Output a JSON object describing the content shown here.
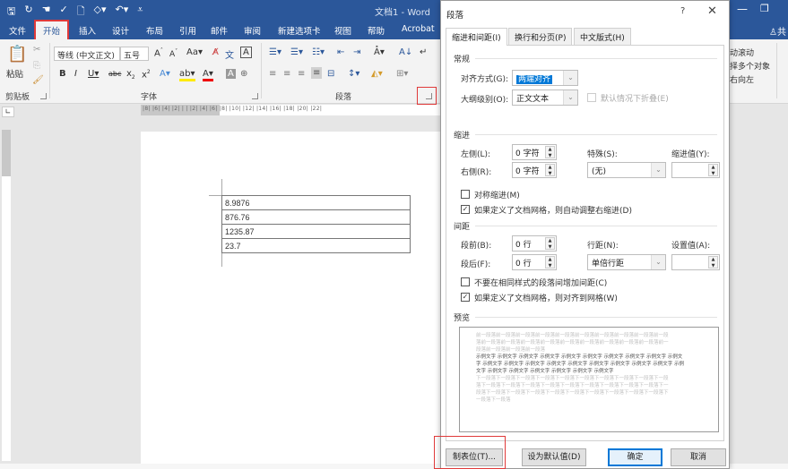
{
  "window": {
    "title": "文档1  -  Word",
    "minimize_icon": "minimize-icon",
    "restore_icon": "restore-icon"
  },
  "qat": {
    "icons": [
      "save-icon",
      "autosave-icon",
      "touch-mode-icon",
      "format-painter-icon",
      "print-preview-icon",
      "shapes-icon",
      "undo-icon",
      "customize-icon"
    ]
  },
  "ribbon_tabs": [
    "文件",
    "开始",
    "插入",
    "设计",
    "布局",
    "引用",
    "邮件",
    "审阅",
    "新建选项卡",
    "视图",
    "帮助",
    "Acrobat"
  ],
  "active_tab": "开始",
  "share_label": "共",
  "ribbon": {
    "clipboard": {
      "paste_label": "粘贴",
      "group_label": "剪贴板"
    },
    "font": {
      "font_name": "等线 (中文正文)",
      "font_size": "五号",
      "group_label": "字体"
    },
    "paragraph": {
      "group_label": "段落"
    },
    "right_partial": [
      "动滚动",
      "择多个对象",
      "右向左"
    ]
  },
  "ruler": {
    "ticks": "|8| |6| |4| |2| |  | |2| |4| |6| |8| |10| |12| |14| |16| |18| |20| |22|"
  },
  "document": {
    "table_rows": [
      "8.9876",
      "876.76",
      "1235.87",
      "23.7"
    ]
  },
  "dialog": {
    "title": "段落",
    "help": "?",
    "close": "✕",
    "tabs": [
      "缩进和间距(I)",
      "换行和分页(P)",
      "中文版式(H)"
    ],
    "active_tab": 0,
    "general": {
      "section": "常规",
      "alignment_label": "对齐方式(G):",
      "alignment_value": "两端对齐",
      "outline_label": "大纲级别(O):",
      "outline_value": "正文文本",
      "collapse_label": "默认情况下折叠(E)",
      "collapse_checked": false
    },
    "indent": {
      "section": "缩进",
      "left_label": "左侧(L):",
      "left_value": "0 字符",
      "right_label": "右侧(R):",
      "right_value": "0 字符",
      "special_label": "特殊(S):",
      "special_value": "(无)",
      "indent_by_label": "缩进值(Y):",
      "indent_by_value": "",
      "mirror_label": "对称缩进(M)",
      "mirror_checked": false,
      "auto_adjust_label": "如果定义了文档网格，则自动调整右缩进(D)",
      "auto_adjust_checked": true
    },
    "spacing": {
      "section": "间距",
      "before_label": "段前(B):",
      "before_value": "0 行",
      "after_label": "段后(F):",
      "after_value": "0 行",
      "line_spacing_label": "行距(N):",
      "line_spacing_value": "单倍行距",
      "at_label": "设置值(A):",
      "at_value": "",
      "no_space_label": "不要在相同样式的段落间增加间距(C)",
      "no_space_checked": false,
      "snap_grid_label": "如果定义了文档网格，则对齐到网格(W)",
      "snap_grid_checked": true
    },
    "preview": {
      "section": "预览",
      "prev_lines": [
        "前一段落前一段落前一段落前一段落前一段落前一段落前一段落前一段落前一段落前一段",
        "落前一段落前一段落前一段落前一段落前一段落前一段落前一段落前一段落前一段落前一",
        "段落前一段落前一段落前一段落"
      ],
      "cur_lines": [
        "示例文字 示例文字 示例文字 示例文字 示例文字 示例文字 示例文字 示例文字 示例文字 示例文",
        "字 示例文字 示例文字 示例文字 示例文字 示例文字 示例文字 示例文字 示例文字 示例文字 示例",
        "文字 示例文字 示例文字 示例文字 示例文字 示例文字 示例文字"
      ],
      "next_lines": [
        "下一段落下一段落下一段落下一段落下一段落下一段落下一段落下一段落下一段落下一段",
        "落下一段落下一段落下一段落下一段落下一段落下一段落下一段落下一段落下一段落下一",
        "段落下一段落下一段落下一段落下一段落下一段落下一段落下一段落下一段落下一段落下",
        "一段落下一段落"
      ]
    },
    "buttons": {
      "tabs": "制表位(T)...",
      "set_default": "设为默认值(D)",
      "ok": "确定",
      "cancel": "取消"
    }
  },
  "highlight_color": "#e03a3a",
  "accent_color": "#2b579a"
}
